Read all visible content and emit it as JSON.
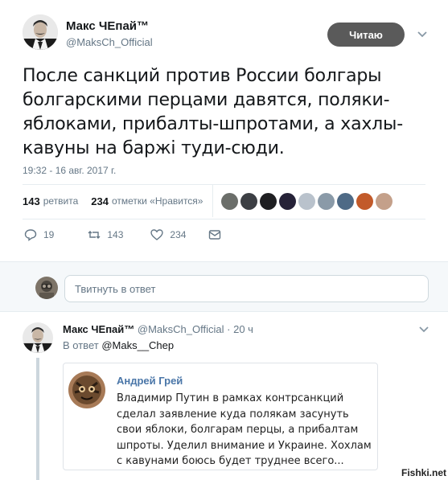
{
  "tweet": {
    "author_name": "Макс ЧЕпай™",
    "author_handle": "@MaksCh_Official",
    "follow_label": "Читаю",
    "text": "После санкций против России болгары болгарскими перцами давятся, поляки- яблоками, прибалты-шпротами, а хахлы- кавуны на баржі туди-сюди.",
    "timestamp": "19:32 - 16 авг. 2017 г.",
    "retweets_count": "143",
    "retweets_label": "ретвита",
    "likes_count": "234",
    "likes_label": "отметки «Нравится»",
    "likers": [
      "#6b6e6a",
      "#3c3f44",
      "#1f1f22",
      "#262238",
      "#b9c2cc",
      "#8a9aa8",
      "#4e6a86",
      "#c25a2a",
      "#c4a08a"
    ],
    "actions": {
      "reply_count": "19",
      "retweet_count": "143",
      "like_count": "234",
      "icons": [
        "reply-icon",
        "retweet-icon",
        "heart-icon",
        "message-icon"
      ]
    }
  },
  "reply_box": {
    "placeholder": "Твитнуть в ответ"
  },
  "reply": {
    "author_name": "Макс ЧЕпай™",
    "author_handle": "@MaksCh_Official",
    "dot": "·",
    "time": "20 ч",
    "replying_prefix": "В ответ",
    "replying_to": "@Maks__Chep",
    "quote": {
      "name": "Андрей Грей",
      "text": "Владимир Путин в рамках контрсанкций сделал заявление куда полякам засунуть свои яблоки, болгарам перцы, а прибалтам шпроты. Уделил внимание и Украине. Хохлам с кавунами боюсь будет труднее всего..."
    }
  },
  "watermark": "Fishki.net",
  "colors": {
    "accent": "#5a5a5a",
    "secondary_text": "#657786",
    "vk_link": "#4a76a8"
  }
}
